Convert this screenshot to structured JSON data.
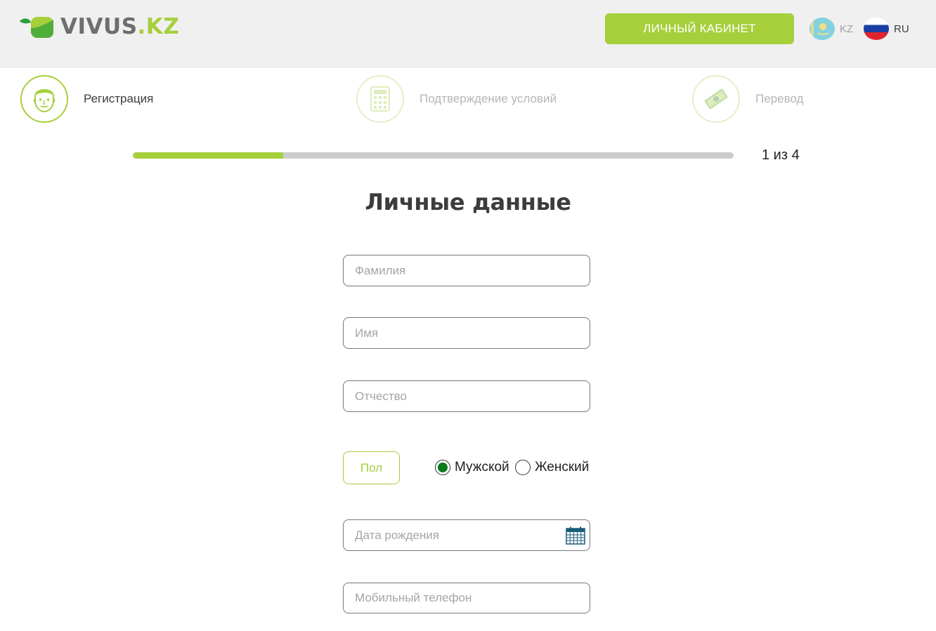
{
  "header": {
    "logo": {
      "main": "VIVUS",
      "suffix": ".KZ"
    },
    "cabinet_label": "ЛИЧНЫЙ КАБИНЕТ",
    "languages": [
      {
        "code": "KZ",
        "flag": "kz-flag-icon",
        "active": false
      },
      {
        "code": "RU",
        "flag": "ru-flag-icon",
        "active": true
      }
    ]
  },
  "steps": [
    {
      "label": "Регистрация",
      "icon": "face-icon",
      "active": true
    },
    {
      "label": "Подтверждение условий",
      "icon": "calculator-icon",
      "active": false
    },
    {
      "label": "Перевод",
      "icon": "money-icon",
      "active": false
    }
  ],
  "progress": {
    "text": "1 из 4",
    "value": 0.25
  },
  "form": {
    "title": "Личные данные",
    "surname": {
      "placeholder": "Фамилия",
      "value": ""
    },
    "name": {
      "placeholder": "Имя",
      "value": ""
    },
    "patronymic": {
      "placeholder": "Отчество",
      "value": ""
    },
    "gender": {
      "label": "Пол",
      "options": [
        {
          "label": "Мужской",
          "selected": true
        },
        {
          "label": "Женский",
          "selected": false
        }
      ]
    },
    "birth_date": {
      "placeholder": "Дата рождения",
      "value": "",
      "icon": "calendar-icon"
    },
    "phone": {
      "placeholder": "Мобильный телефон",
      "value": ""
    }
  },
  "colors": {
    "accent": "#a6cf3c",
    "header_bg": "#f0f0f0",
    "radio_selected": "#0a7a1a",
    "track": "#cccccc"
  }
}
